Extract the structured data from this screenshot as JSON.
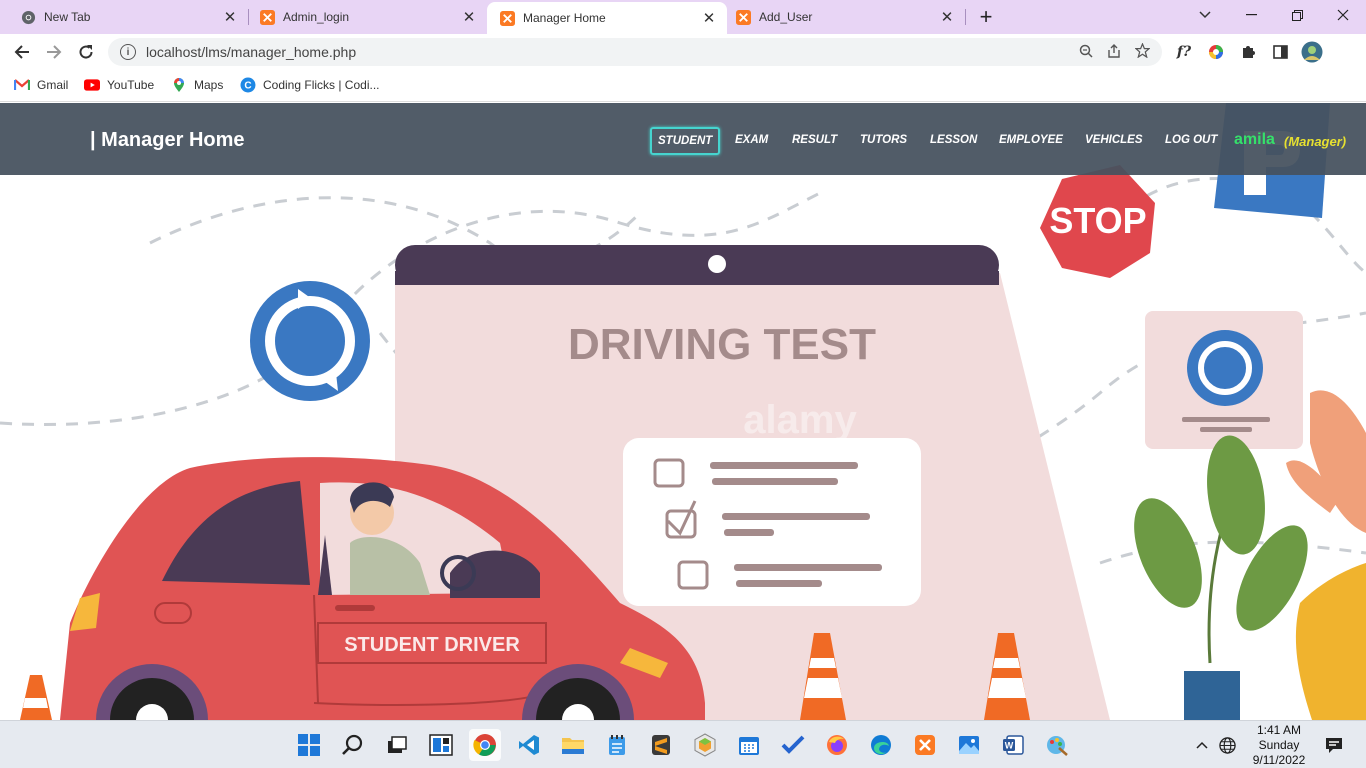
{
  "browser": {
    "tabs": [
      {
        "title": "New Tab",
        "icon": "chrome-icon",
        "close": "✕"
      },
      {
        "title": "Admin_login",
        "icon": "xampp-icon",
        "close": "✕"
      },
      {
        "title": "Manager Home",
        "icon": "xampp-icon",
        "close": "✕",
        "active": true
      },
      {
        "title": "Add_User",
        "icon": "xampp-icon",
        "close": "✕"
      }
    ],
    "new_tab": "+",
    "url": "localhost/lms/manager_home.php",
    "bookmarks": [
      {
        "label": "Gmail",
        "icon": "gmail-icon"
      },
      {
        "label": "YouTube",
        "icon": "youtube-icon"
      },
      {
        "label": "Maps",
        "icon": "maps-icon"
      },
      {
        "label": "Coding Flicks | Codi...",
        "icon": "coding-flicks-icon"
      }
    ]
  },
  "site": {
    "brand": "| Manager Home",
    "menu": [
      "STUDENT",
      "EXAM",
      "RESULT",
      "TUTORS",
      "LESSON",
      "EMPLOYEE",
      "VEHICLES",
      "LOG OUT"
    ],
    "selected_menu": "STUDENT",
    "user": "amila",
    "role": "(Manager)",
    "hero": {
      "board_text": "DRIVING TEST",
      "car_text": "STUDENT DRIVER",
      "stop_text": "STOP",
      "watermark": "alamy"
    },
    "colors": {
      "navbar": "#46525f",
      "accent": "#46d4cf",
      "user": "#35e06a",
      "role": "#e6e030"
    }
  },
  "taskbar": {
    "time": "1:41 AM",
    "day": "Sunday",
    "date": "9/11/2022"
  }
}
